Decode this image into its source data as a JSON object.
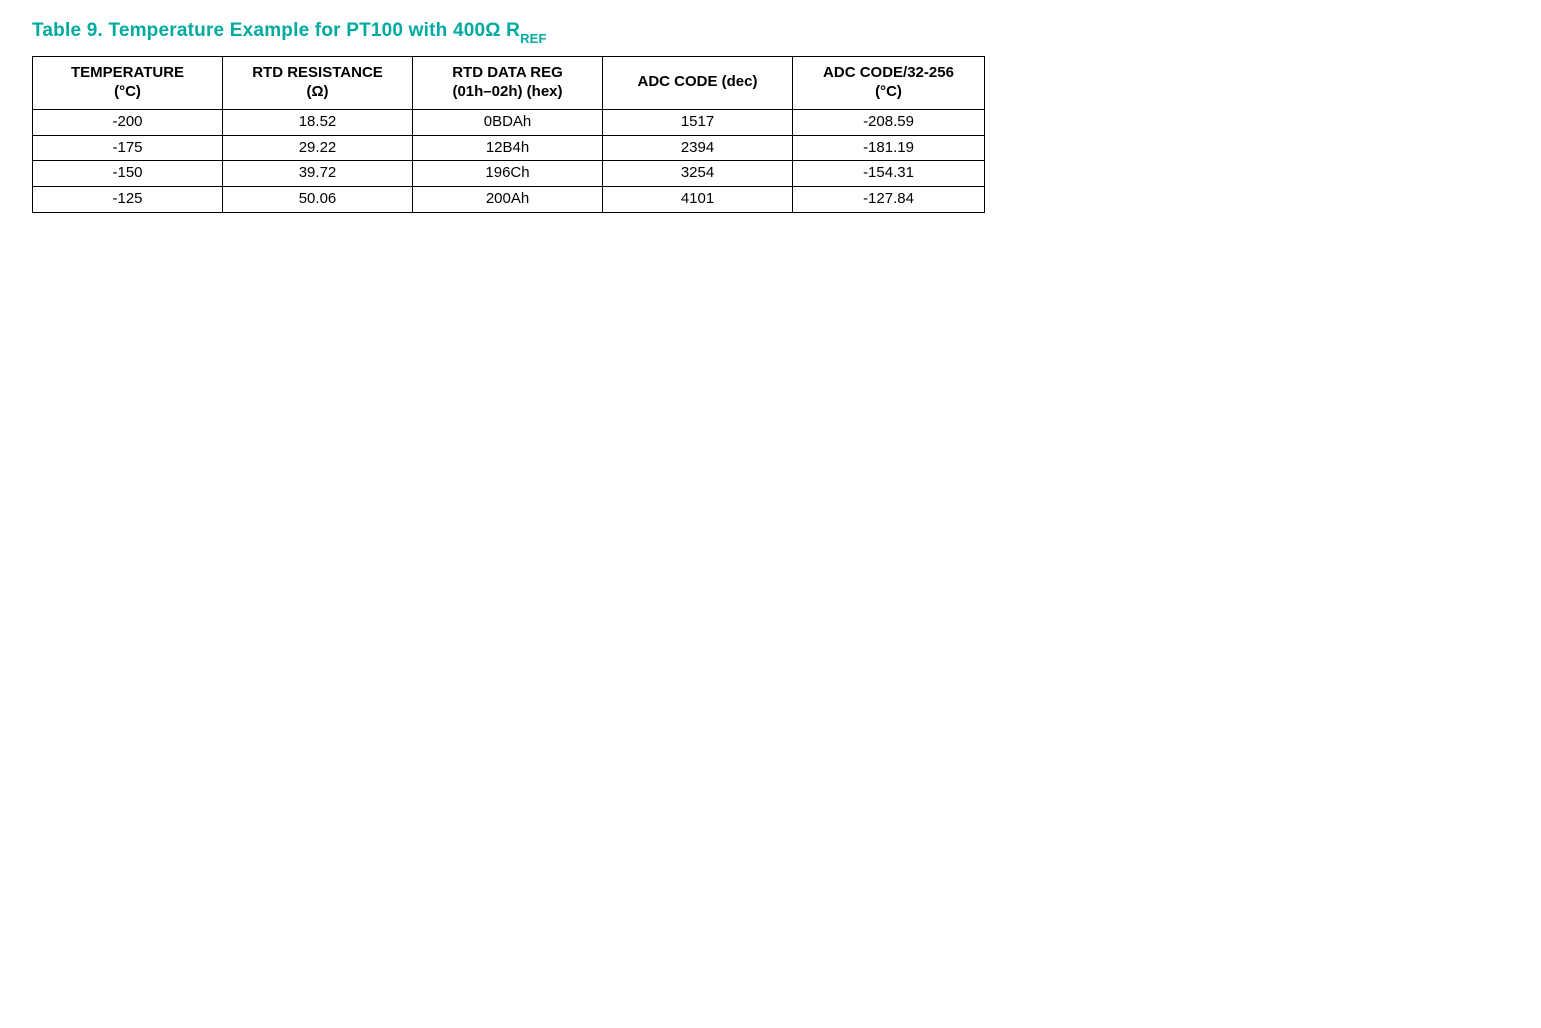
{
  "title_prefix": "Table 9. Temperature Example for PT100 with 400Ω R",
  "title_sub": "REF",
  "headers": {
    "col1_l1": "TEMPERATURE",
    "col1_l2": "(°C)",
    "col2_l1": "RTD RESISTANCE",
    "col2_l2": "(Ω)",
    "col3_l1": "RTD DATA REG",
    "col3_l2": "(01h–02h) (hex)",
    "col4_l1": "ADC CODE (dec)",
    "col5_l1": "ADC CODE/32-256",
    "col5_l2": "(°C)"
  },
  "rows": [
    {
      "temp": "-200",
      "res": "18.52",
      "reg": "0BDAh",
      "adc": "1517",
      "calc": "-208.59"
    },
    {
      "temp": "-175",
      "res": "29.22",
      "reg": "12B4h",
      "adc": "2394",
      "calc": "-181.19"
    },
    {
      "temp": "-150",
      "res": "39.72",
      "reg": "196Ch",
      "adc": "3254",
      "calc": "-154.31"
    },
    {
      "temp": "-125",
      "res": "50.06",
      "reg": "200Ah",
      "adc": "4101",
      "calc": "-127.84"
    }
  ],
  "chart_data": {
    "type": "table",
    "title": "Table 9. Temperature Example for PT100 with 400Ω RREF",
    "columns": [
      "TEMPERATURE (°C)",
      "RTD RESISTANCE (Ω)",
      "RTD DATA REG (01h–02h) (hex)",
      "ADC CODE (dec)",
      "ADC CODE/32-256 (°C)"
    ],
    "data": [
      [
        -200,
        18.52,
        "0BDAh",
        1517,
        -208.59
      ],
      [
        -175,
        29.22,
        "12B4h",
        2394,
        -181.19
      ],
      [
        -150,
        39.72,
        "196Ch",
        3254,
        -154.31
      ],
      [
        -125,
        50.06,
        "200Ah",
        4101,
        -127.84
      ]
    ]
  }
}
